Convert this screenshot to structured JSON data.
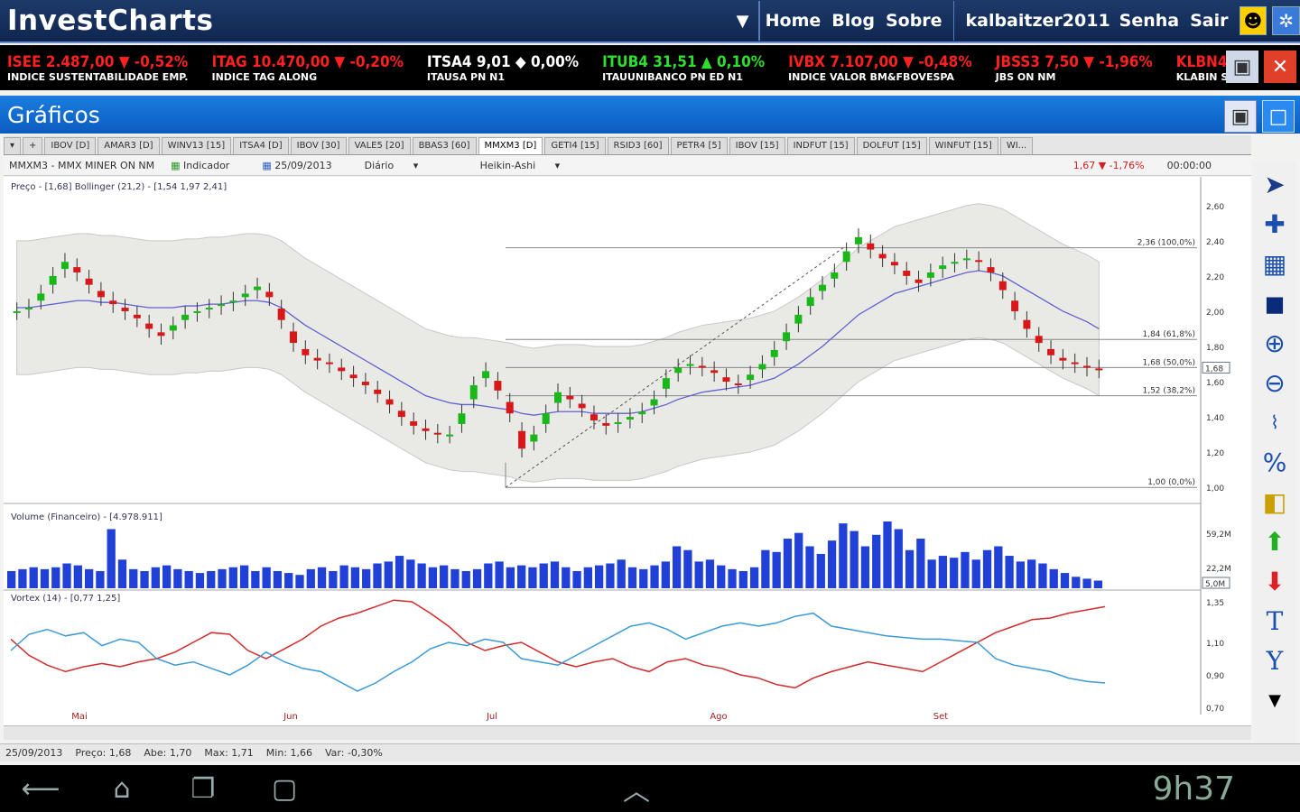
{
  "app": {
    "title": "InvestCharts"
  },
  "nav": {
    "home": "Home",
    "blog": "Blog",
    "about": "Sobre",
    "user": "kalbaitzer2011",
    "password": "Senha",
    "logout": "Sair"
  },
  "ticker": [
    {
      "code": "ISEE",
      "value": "2.487,00",
      "dir": "down",
      "arrow": "▼",
      "change": "-0,52%",
      "name": "INDICE SUSTENTABILIDADE EMP."
    },
    {
      "code": "ITAG",
      "value": "10.470,00",
      "dir": "down",
      "arrow": "▼",
      "change": "-0,20%",
      "name": "INDICE TAG ALONG"
    },
    {
      "code": "ITSA4",
      "value": "9,01",
      "dir": "flat",
      "arrow": "◆",
      "change": "0,00%",
      "name": "ITAUSA PN N1"
    },
    {
      "code": "ITUB4",
      "value": "31,51",
      "dir": "up",
      "arrow": "▲",
      "change": "0,10%",
      "name": "ITAUUNIBANCO PN ED N1"
    },
    {
      "code": "IVBX",
      "value": "7.107,00",
      "dir": "down",
      "arrow": "▼",
      "change": "-0,48%",
      "name": "INDICE VALOR BM&FBOVESPA"
    },
    {
      "code": "JBSS3",
      "value": "7,50",
      "dir": "down",
      "arrow": "▼",
      "change": "-1,96%",
      "name": "JBS ON NM"
    },
    {
      "code": "KLBN4",
      "value": "",
      "dir": "down",
      "arrow": "",
      "change": "",
      "name": "KLABIN S/"
    }
  ],
  "section": {
    "title": "Gráficos"
  },
  "tabs": [
    "IBOV [D]",
    "AMAR3 [D]",
    "WINV13 [15]",
    "ITSA4 [D]",
    "IBOV [30]",
    "VALE5 [20]",
    "BBAS3 [60]",
    "MMXM3 [D]",
    "GETI4 [15]",
    "RSID3 [60]",
    "PETR4 [5]",
    "IBOV [15]",
    "INDFUT [15]",
    "DOLFUT [15]",
    "WINFUT [15]",
    "WI..."
  ],
  "active_tab": "MMXM3 [D]",
  "toolbar": {
    "symbol": "MMXM3 - MMX MINER ON NM",
    "indicator": "Indicador",
    "date": "25/09/2013",
    "period": "Diário",
    "style": "Heikin-Ashi",
    "quote": "1,67 ▼ -1,76%",
    "time": "00:00:00"
  },
  "panels": {
    "price_label": "Preço - [1,68]   Bollinger (21,2) - [1,54  1,97  2,41]",
    "volume_label": "Volume (Financeiro) - [4.978.911]",
    "vortex_label": "Vortex (14) - [0,77  1,25]"
  },
  "chart_data": [
    {
      "type": "candlestick",
      "title": "Preço",
      "ylim": [
        0.95,
        2.65
      ],
      "yticks": [
        "2,60",
        "2,40",
        "2,20",
        "2,00",
        "1,80",
        "1,60",
        "1,40",
        "1,20",
        "1,00"
      ],
      "fib": [
        {
          "label": "2,36 (100,0%)",
          "v": 2.36
        },
        {
          "label": "1,84 (61,8%)",
          "v": 1.84
        },
        {
          "label": "1,68 (50,0%)",
          "v": 1.68
        },
        {
          "label": "1,52 (38,2%)",
          "v": 1.52
        },
        {
          "label": "1,00 (0,0%)",
          "v": 1.0
        }
      ],
      "last": "1,68",
      "xlabels": [
        "Mai",
        "Jun",
        "Jul",
        "Ago",
        "Set"
      ],
      "close": [
        2.0,
        2.02,
        2.1,
        2.2,
        2.28,
        2.22,
        2.15,
        2.08,
        2.04,
        2.0,
        1.96,
        1.9,
        1.86,
        1.92,
        1.98,
        2.0,
        2.02,
        2.04,
        2.06,
        2.1,
        2.14,
        2.08,
        1.95,
        1.82,
        1.75,
        1.72,
        1.7,
        1.66,
        1.62,
        1.58,
        1.53,
        1.47,
        1.4,
        1.35,
        1.32,
        1.3,
        1.3,
        1.42,
        1.58,
        1.66,
        1.55,
        1.42,
        1.22,
        1.3,
        1.42,
        1.54,
        1.5,
        1.45,
        1.38,
        1.35,
        1.37,
        1.4,
        1.43,
        1.5,
        1.62,
        1.68,
        1.7,
        1.68,
        1.65,
        1.6,
        1.58,
        1.64,
        1.7,
        1.78,
        1.88,
        1.98,
        2.08,
        2.15,
        2.22,
        2.34,
        2.42,
        2.35,
        2.3,
        2.26,
        2.2,
        2.16,
        2.22,
        2.26,
        2.28,
        2.3,
        2.28,
        2.22,
        2.12,
        2.0,
        1.9,
        1.82,
        1.75,
        1.72,
        1.7,
        1.68,
        1.67
      ],
      "mid": [
        2.02,
        2.02,
        2.03,
        2.04,
        2.05,
        2.06,
        2.06,
        2.05,
        2.05,
        2.04,
        2.03,
        2.02,
        2.02,
        2.02,
        2.03,
        2.03,
        2.04,
        2.04,
        2.05,
        2.06,
        2.06,
        2.05,
        2.02,
        1.97,
        1.92,
        1.88,
        1.84,
        1.8,
        1.76,
        1.72,
        1.68,
        1.64,
        1.6,
        1.56,
        1.52,
        1.5,
        1.48,
        1.47,
        1.47,
        1.46,
        1.45,
        1.44,
        1.42,
        1.41,
        1.42,
        1.43,
        1.43,
        1.43,
        1.42,
        1.42,
        1.42,
        1.42,
        1.43,
        1.45,
        1.47,
        1.5,
        1.52,
        1.54,
        1.55,
        1.56,
        1.57,
        1.58,
        1.6,
        1.62,
        1.66,
        1.7,
        1.75,
        1.8,
        1.86,
        1.92,
        1.98,
        2.02,
        2.06,
        2.1,
        2.12,
        2.14,
        2.16,
        2.18,
        2.2,
        2.22,
        2.23,
        2.22,
        2.2,
        2.16,
        2.12,
        2.08,
        2.04,
        2.0,
        1.97,
        1.94,
        1.9
      ]
    },
    {
      "type": "bar",
      "title": "Volume (Financeiro)",
      "yticks": [
        "59,2M",
        "22,2M"
      ],
      "last": "5,0M",
      "values": [
        18,
        20,
        22,
        20,
        22,
        26,
        24,
        20,
        18,
        62,
        30,
        20,
        18,
        22,
        24,
        20,
        18,
        16,
        18,
        20,
        22,
        24,
        18,
        22,
        18,
        16,
        14,
        20,
        22,
        18,
        24,
        22,
        20,
        26,
        28,
        34,
        30,
        26,
        22,
        24,
        20,
        18,
        20,
        26,
        28,
        22,
        24,
        22,
        26,
        28,
        22,
        18,
        22,
        24,
        26,
        30,
        22,
        20,
        24,
        28,
        44,
        40,
        28,
        30,
        24,
        20,
        18,
        22,
        40,
        38,
        52,
        58,
        44,
        36,
        50,
        68,
        60,
        44,
        56,
        70,
        62,
        40,
        52,
        30,
        34,
        32,
        38,
        30,
        40,
        44,
        34,
        28,
        30,
        26,
        20,
        16,
        12,
        10,
        8
      ]
    },
    {
      "type": "line",
      "title": "Vortex (14)",
      "yticks": [
        "1,35",
        "1,10",
        "0,90",
        "0,70"
      ],
      "series": [
        {
          "name": "",
          "color": "#d42a2a",
          "values": [
            1.12,
            1.02,
            0.96,
            0.92,
            0.95,
            0.97,
            0.95,
            0.98,
            1.0,
            1.04,
            1.1,
            1.16,
            1.15,
            1.05,
            1.0,
            1.06,
            1.12,
            1.2,
            1.25,
            1.28,
            1.32,
            1.36,
            1.35,
            1.28,
            1.2,
            1.1,
            1.05,
            1.08,
            1.1,
            1.04,
            0.98,
            0.95,
            0.98,
            1.0,
            0.95,
            0.92,
            0.98,
            1.0,
            0.96,
            0.94,
            0.9,
            0.88,
            0.84,
            0.82,
            0.88,
            0.92,
            0.95,
            0.98,
            0.96,
            0.94,
            0.92,
            0.98,
            1.04,
            1.1,
            1.16,
            1.2,
            1.24,
            1.25,
            1.28,
            1.3,
            1.32
          ]
        },
        {
          "name": "",
          "color": "#3a9ad8",
          "values": [
            1.05,
            1.15,
            1.18,
            1.14,
            1.16,
            1.08,
            1.12,
            1.1,
            1.0,
            0.96,
            0.98,
            0.94,
            0.9,
            0.96,
            1.04,
            0.98,
            0.94,
            0.92,
            0.86,
            0.8,
            0.85,
            0.92,
            0.98,
            1.06,
            1.1,
            1.08,
            1.12,
            1.1,
            1.0,
            0.98,
            0.96,
            1.02,
            1.08,
            1.14,
            1.2,
            1.22,
            1.18,
            1.12,
            1.16,
            1.2,
            1.22,
            1.2,
            1.22,
            1.26,
            1.28,
            1.2,
            1.18,
            1.16,
            1.14,
            1.13,
            1.12,
            1.12,
            1.11,
            1.1,
            1.0,
            0.96,
            0.94,
            0.92,
            0.88,
            0.86,
            0.85
          ]
        }
      ]
    }
  ],
  "status": {
    "date": "25/09/2013",
    "price": "Preço: 1,68",
    "open": "Abe: 1,70",
    "max": "Max: 1,71",
    "min": "Min: 1,66",
    "var": "Var: -0,30%"
  },
  "system": {
    "clock": "9h37"
  }
}
